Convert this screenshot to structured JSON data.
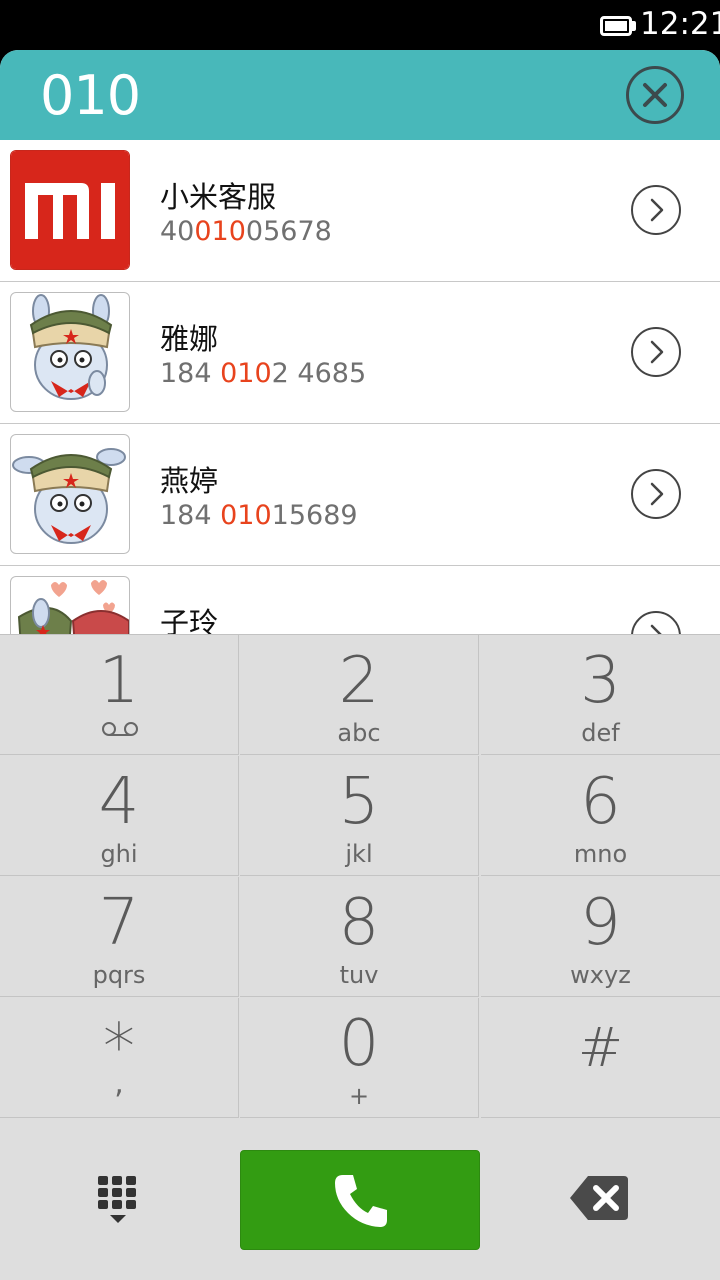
{
  "status_bar": {
    "time": "12:21",
    "battery_icon": "battery-full-icon"
  },
  "header": {
    "dialed_number": "010",
    "clear_icon": "clear-circle-icon",
    "accent_color": "#48b8ba"
  },
  "contacts": [
    {
      "name": "小米客服",
      "number_pre": "40",
      "number_match": "010",
      "number_post": "05678",
      "avatar": "mi-logo"
    },
    {
      "name": "雅娜",
      "number_pre": "184 ",
      "number_match": "010",
      "number_post": "2 4685",
      "avatar": "mitu-bunny"
    },
    {
      "name": "燕婷",
      "number_pre": "184 ",
      "number_match": "010",
      "number_post": "15689",
      "avatar": "mitu-bunny"
    },
    {
      "name": "子玲",
      "number_pre": "",
      "number_match": "",
      "number_post": "",
      "avatar": "mitu-bunny-hearts"
    }
  ],
  "highlight_color": "#e8431d",
  "keypad": {
    "keys": [
      {
        "digit": "1",
        "letters": ""
      },
      {
        "digit": "2",
        "letters": "abc"
      },
      {
        "digit": "3",
        "letters": "def"
      },
      {
        "digit": "4",
        "letters": "ghi"
      },
      {
        "digit": "5",
        "letters": "jkl"
      },
      {
        "digit": "6",
        "letters": "mno"
      },
      {
        "digit": "7",
        "letters": "pqrs"
      },
      {
        "digit": "8",
        "letters": "tuv"
      },
      {
        "digit": "9",
        "letters": "wxyz"
      },
      {
        "digit": "*",
        "letters": ","
      },
      {
        "digit": "0",
        "letters": "+"
      },
      {
        "digit": "#",
        "letters": ""
      }
    ]
  },
  "actions": {
    "dialpad_icon": "dialpad-hide-icon",
    "call_icon": "phone-icon",
    "call_color": "#339c12",
    "backspace_icon": "backspace-icon"
  }
}
